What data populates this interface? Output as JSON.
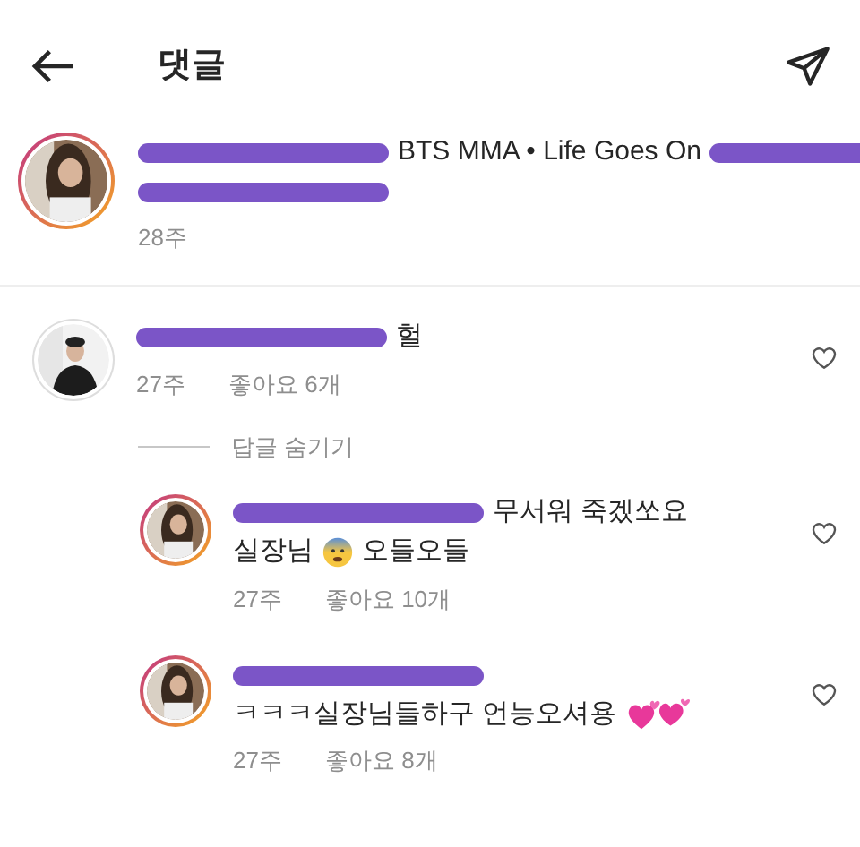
{
  "header": {
    "title": "댓글"
  },
  "caption": {
    "story_ring": true,
    "lines": [
      [
        {
          "kind": "redacted"
        },
        {
          "kind": "text",
          "text": "BTS MMA • Life Goes On"
        },
        {
          "kind": "redacted"
        }
      ],
      [
        {
          "kind": "redacted"
        }
      ]
    ],
    "time": "28주"
  },
  "comments": [
    {
      "story_ring": false,
      "lines": [
        [
          {
            "kind": "redacted"
          },
          {
            "kind": "text",
            "text": "헐"
          }
        ]
      ],
      "time": "27주",
      "likes": "좋아요 6개"
    }
  ],
  "replies_toggle": "답글 숨기기",
  "replies": [
    {
      "story_ring": true,
      "lines": [
        [
          {
            "kind": "redacted"
          },
          {
            "kind": "text",
            "text": "무서워 죽겠쏘요"
          }
        ],
        [
          {
            "kind": "text",
            "text": "실장님"
          },
          {
            "kind": "scared-emoji"
          },
          {
            "kind": "text",
            "text": "오들오들"
          }
        ]
      ],
      "time": "27주",
      "likes": "좋아요 10개"
    },
    {
      "story_ring": true,
      "lines": [
        [
          {
            "kind": "redacted"
          }
        ],
        [
          {
            "kind": "text",
            "text": "ㅋㅋㅋ실장님들하구 언능오셔용"
          },
          {
            "kind": "hearts-emoji"
          }
        ]
      ],
      "time": "27주",
      "likes": "좋아요 8개"
    }
  ]
}
